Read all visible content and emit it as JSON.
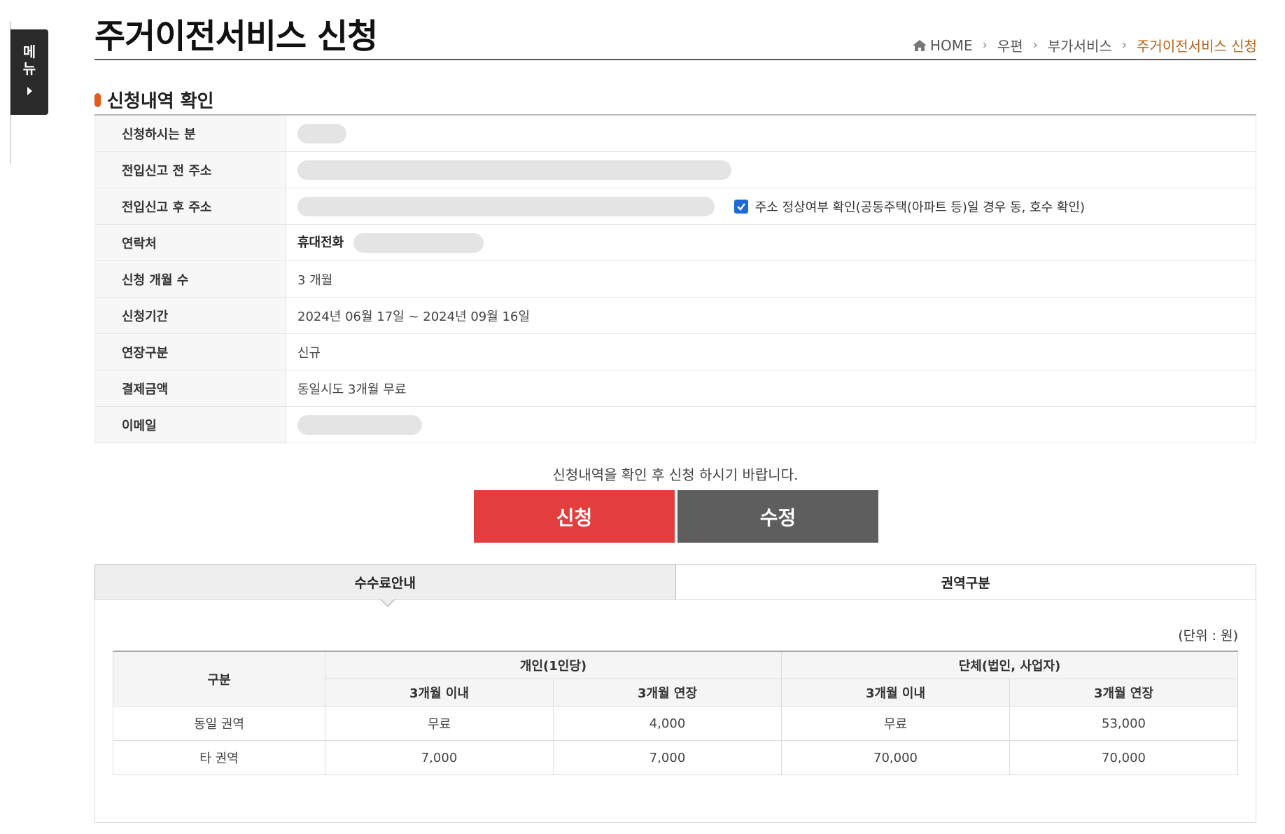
{
  "side_menu": {
    "label": "메뉴"
  },
  "header": {
    "title": "주거이전서비스 신청",
    "breadcrumb": [
      "HOME",
      "우편",
      "부가서비스",
      "주거이전서비스 신청"
    ]
  },
  "section": {
    "title": "신청내역 확인"
  },
  "details": {
    "applicant_label": "신청하시는 분",
    "before_address_label": "전입신고 전 주소",
    "after_address_label": "전입신고 후 주소",
    "address_check_text": "주소 정상여부 확인(공동주택(아파트 등)일 경우 동, 호수 확인)",
    "address_check_checked": true,
    "contact_label": "연락처",
    "contact_type": "휴대전화",
    "months_label": "신청 개월 수",
    "months_value": "3 개월",
    "period_label": "신청기간",
    "period_value": "2024년 06월 17일 ~ 2024년 09월 16일",
    "extension_label": "연장구분",
    "extension_value": "신규",
    "payment_label": "결제금액",
    "payment_value": "동일시도 3개월 무료",
    "email_label": "이메일"
  },
  "notice": "신청내역을 확인 후 신청 하시기 바랍니다.",
  "buttons": {
    "apply": "신청",
    "edit": "수정"
  },
  "tabs": [
    {
      "label": "수수료안내",
      "active": true
    },
    {
      "label": "권역구분",
      "active": false
    }
  ],
  "fee": {
    "unit": "(단위 : 원)",
    "col_category": "구분",
    "group_personal": "개인(1인당)",
    "group_corp": "단체(법인, 사업자)",
    "sub_within": "3개월 이내",
    "sub_extend": "3개월 연장",
    "rows": [
      {
        "region": "동일 권역",
        "p_within": "무료",
        "p_extend": "4,000",
        "c_within": "무료",
        "c_extend": "53,000"
      },
      {
        "region": "타 권역",
        "p_within": "7,000",
        "p_extend": "7,000",
        "c_within": "70,000",
        "c_extend": "70,000"
      }
    ]
  },
  "colors": {
    "accent": "#e35a1a",
    "apply": "#e33d3d",
    "edit": "#5e5e5e",
    "breadcrumb_current": "#b5651d",
    "checkbox": "#1e6bd6"
  }
}
